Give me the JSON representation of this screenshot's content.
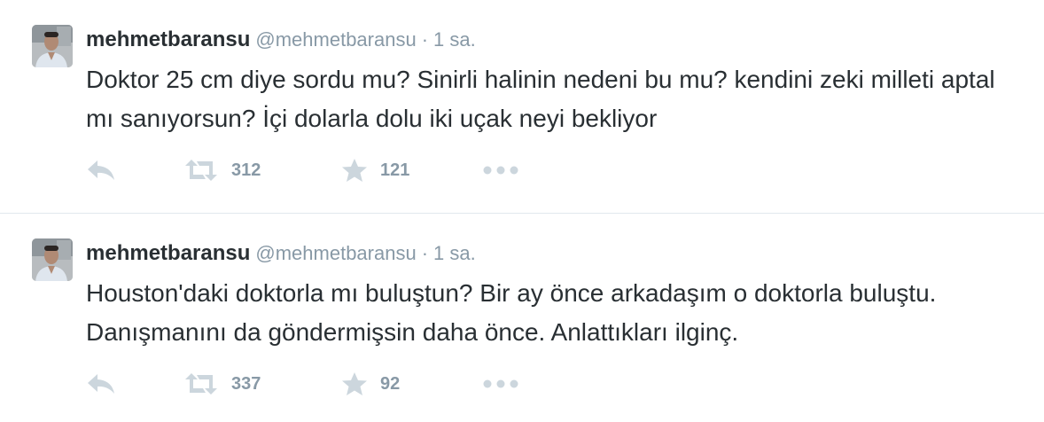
{
  "tweets": [
    {
      "name": "mehmetbaransu",
      "handle": "@mehmetbaransu",
      "separator": "·",
      "time": "1 sa.",
      "text": "Doktor 25 cm diye sordu mu? Sinirli halinin nedeni bu mu? kendini zeki milleti aptal mı sanıyorsun? İçi dolarla dolu iki uçak neyi bekliyor",
      "retweets": "312",
      "favorites": "121"
    },
    {
      "name": "mehmetbaransu",
      "handle": "@mehmetbaransu",
      "separator": "·",
      "time": "1 sa.",
      "text": "Houston'daki doktorla mı buluştun? Bir ay önce arkadaşım o doktorla buluştu. Danışmanını da göndermişsin daha önce. Anlattıkları ilginç.",
      "retweets": "337",
      "favorites": "92"
    }
  ],
  "icons": {
    "reply": "reply-icon",
    "retweet": "retweet-icon",
    "favorite": "star-icon",
    "more": "more-dots-icon"
  },
  "colors": {
    "text": "#292f33",
    "muted": "#8899a6",
    "icon": "#ccd6dd",
    "divider": "#e1e8ed"
  }
}
